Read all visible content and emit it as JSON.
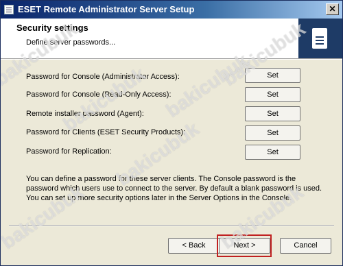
{
  "window": {
    "title": "ESET Remote Administrator Server Setup",
    "close_glyph": "✕"
  },
  "header": {
    "title": "Security settings",
    "subtitle": "Define server passwords..."
  },
  "passwords": [
    {
      "label": "Password for Console (Administrator Access):",
      "button": "Set"
    },
    {
      "label": "Password for Console (Read-Only Access):",
      "button": "Set"
    },
    {
      "label": "Remote installer password (Agent):",
      "button": "Set"
    },
    {
      "label": "Password for Clients (ESET Security Products):",
      "button": "Set"
    },
    {
      "label": "Password for Replication:",
      "button": "Set"
    }
  ],
  "description": "You can define a password for these server clients. The Console password is the password which users use to connect to the server. By default a blank password is used. You can set up more security options later in the Server Options in the Console.",
  "nav": {
    "back": "< Back",
    "next": "Next >",
    "cancel": "Cancel"
  },
  "watermark": "bakicubuk",
  "colors": {
    "title_bar": "#0a246a",
    "banner": "#1e3b66",
    "highlight": "#c02020",
    "dialog_bg": "#ece9d8"
  }
}
